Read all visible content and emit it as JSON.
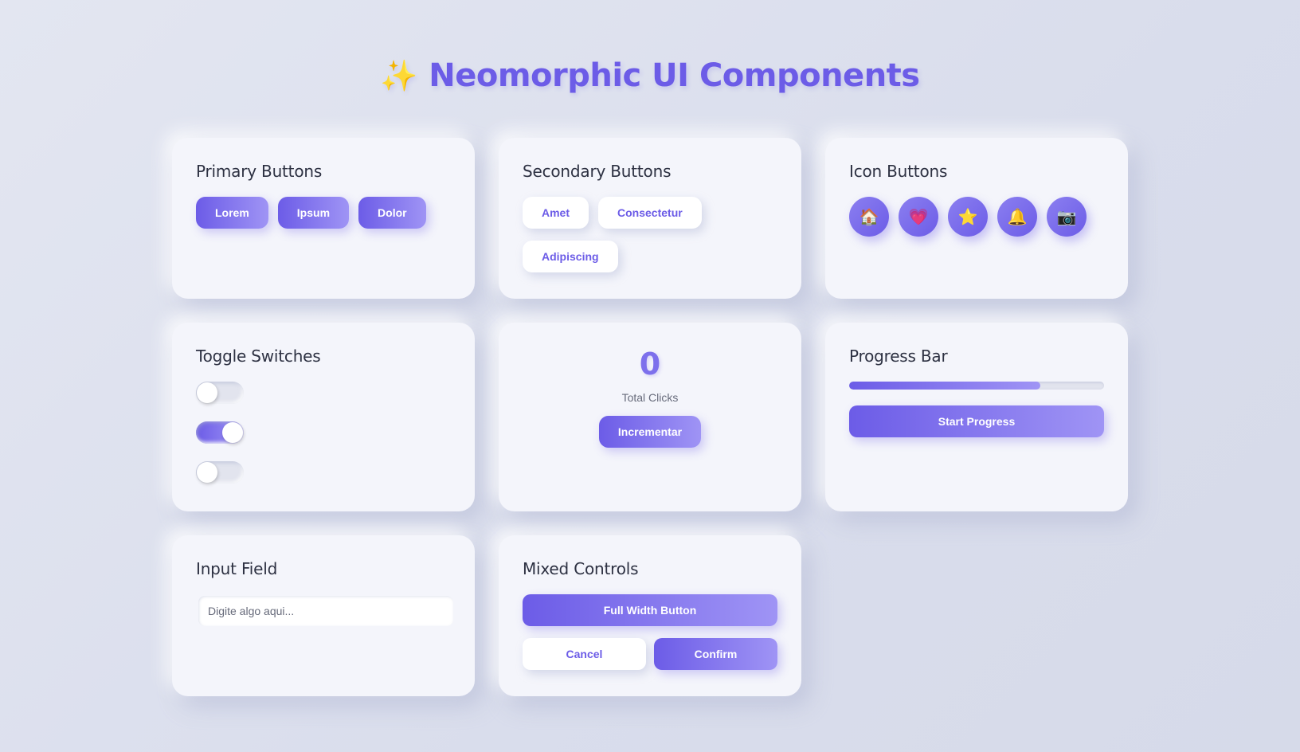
{
  "page": {
    "title": "Neomorphic UI Components",
    "title_icon": "✨",
    "accent": "#6c5ce7"
  },
  "primary": {
    "heading": "Primary Buttons",
    "buttons": [
      "Lorem",
      "Ipsum",
      "Dolor"
    ]
  },
  "secondary": {
    "heading": "Secondary Buttons",
    "buttons": [
      "Amet",
      "Consectetur",
      "Adipiscing"
    ]
  },
  "icons": {
    "heading": "Icon Buttons",
    "items": [
      {
        "name": "house-icon",
        "glyph": "🏠"
      },
      {
        "name": "heart-icon",
        "glyph": "💗"
      },
      {
        "name": "star-icon",
        "glyph": "⭐"
      },
      {
        "name": "bell-icon",
        "glyph": "🔔"
      },
      {
        "name": "camera-icon",
        "glyph": "📷"
      }
    ]
  },
  "toggles": {
    "heading": "Toggle Switches",
    "states": [
      false,
      true,
      false
    ]
  },
  "counter": {
    "value": "0",
    "label": "Total Clicks",
    "button": "Incrementar"
  },
  "progress": {
    "heading": "Progress Bar",
    "percent": 75,
    "button": "Start Progress"
  },
  "input": {
    "heading": "Input Field",
    "placeholder": "Digite algo aqui...",
    "value": ""
  },
  "mixed": {
    "heading": "Mixed Controls",
    "full_button": "Full Width Button",
    "cancel": "Cancel",
    "confirm": "Confirm"
  }
}
